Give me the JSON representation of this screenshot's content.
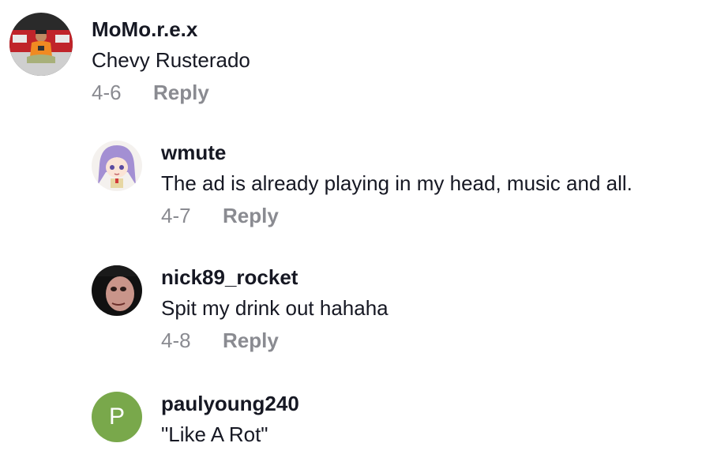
{
  "comments": [
    {
      "username": "MoMo.r.e.x",
      "text": "Chevy Rusterado",
      "date": "4-6",
      "reply_label": "Reply",
      "avatar": "photo-person-red-truck"
    },
    {
      "username": "wmute",
      "text": "The ad is already playing in my head, music and all.",
      "date": "4-7",
      "reply_label": "Reply",
      "avatar": "anime-girl-purple-hair"
    },
    {
      "username": "nick89_rocket",
      "text": "Spit my drink out hahaha",
      "date": "4-8",
      "reply_label": "Reply",
      "avatar": "photo-face-closeup"
    },
    {
      "username": "paulyoung240",
      "text": "\"Like A Rot\"",
      "avatar_letter": "P",
      "avatar_color": "#79a84b"
    }
  ]
}
